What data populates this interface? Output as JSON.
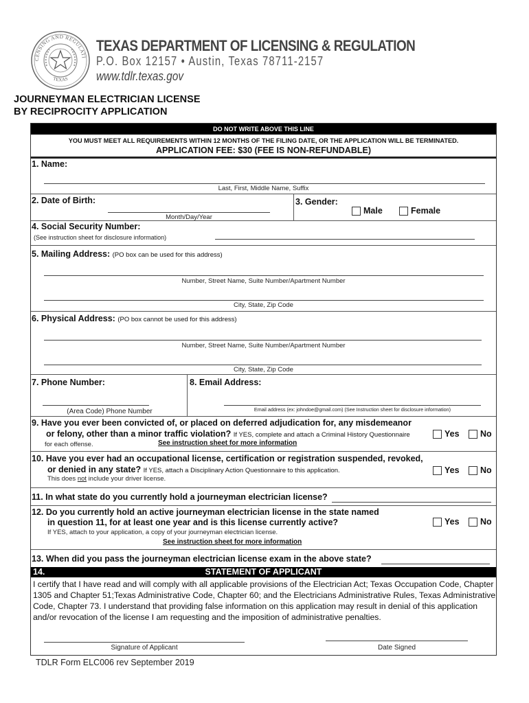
{
  "header": {
    "seal_icon": "tdlr-seal-icon",
    "seal_text_top": "LICENSING AND REGULATION",
    "seal_text_bottom": "TEXAS",
    "agency": "TEXAS DEPARTMENT OF LICENSING & REGULATION",
    "address": "P.O. Box 12157 • Austin, Texas 78711-2157",
    "website": "www.tdlr.texas.gov",
    "form_title_line1": "JOURNEYMAN ELECTRICIAN LICENSE",
    "form_title_line2": "BY RECIPROCITY APPLICATION"
  },
  "banner": {
    "do_not_write": "DO NOT WRITE ABOVE THIS LINE",
    "requirement_notice": "YOU MUST MEET ALL REQUIREMENTS WITHIN 12 MONTHS OF THE FILING DATE, OR THE APPLICATION WILL BE TERMINATED.",
    "fee": "APPLICATION FEE: $30 (FEE IS NON-REFUNDABLE)"
  },
  "fields": {
    "name": {
      "label": "1. Name:",
      "caption": "Last, First, Middle Name, Suffix",
      "value": ""
    },
    "dob": {
      "label": "2. Date of Birth:",
      "caption": "Month/Day/Year",
      "value": ""
    },
    "gender": {
      "label": "3. Gender:",
      "options": [
        "Male",
        "Female"
      ],
      "selected": null
    },
    "ssn": {
      "label": "4. Social Security Number:",
      "note": "(See instruction sheet for disclosure information)",
      "value": ""
    },
    "mailing": {
      "label": "5. Mailing Address:",
      "note": "(PO box can be used for this address)",
      "caption_street": "Number, Street Name, Suite Number/Apartment Number",
      "caption_city": "City, State, Zip Code"
    },
    "physical": {
      "label": "6. Physical Address:",
      "note": "(PO box cannot be used for this address)",
      "caption_street": "Number, Street Name, Suite Number/Apartment Number",
      "caption_city": "City, State, Zip Code"
    },
    "phone": {
      "label": "7. Phone Number:",
      "caption": "(Area Code) Phone Number",
      "value": ""
    },
    "email": {
      "label": "8. Email Address:",
      "caption": "Email address (ex: johndoe@gmail.com) (See Instruction sheet for disclosure information)",
      "value": ""
    }
  },
  "questions": {
    "q9": {
      "line1": "9.  Have you ever been convicted of, or placed on deferred adjudication for, any misdemeanor",
      "line2": "or felony, other than a minor traffic violation?",
      "note": "If YES, complete and attach a Criminal History Questionnaire",
      "note2": "for each offense.",
      "link": "See instruction sheet for more information",
      "yes": "Yes",
      "no": "No"
    },
    "q10": {
      "line1": "10. Have you ever had an occupational license, certification or registration suspended, revoked,",
      "line2": "or denied in any state?",
      "note": "If YES, attach a Disciplinary Action Questionnaire to this application.",
      "note2_pre": "This does ",
      "note2_em": "not",
      "note2_post": " include your driver license.",
      "yes": "Yes",
      "no": "No"
    },
    "q11": {
      "text": "11. In what state do you currently hold a journeyman electrician license?",
      "value": ""
    },
    "q12": {
      "line1": "12. Do you currently hold an active journeyman electrician license in the state named",
      "line2": "in question 11, for at least one year and is this license currently active?",
      "note": "If YES, attach to your application, a copy of your journeyman electrician license.",
      "link": "See instruction sheet for more information",
      "yes": "Yes",
      "no": "No"
    },
    "q13": {
      "text": "13. When did you pass the journeyman electrician license exam in the above state?",
      "value": ""
    }
  },
  "statement": {
    "number": "14.",
    "title": "STATEMENT OF APPLICANT",
    "body": "I certify that I have read and will comply with all applicable provisions of the Electrician Act; Texas Occupation Code, Chapter 1305 and Chapter 51;Texas Administrative Code, Chapter 60; and the Electricians Administrative Rules, Texas Administrative Code, Chapter 73. I understand that providing false information on this application may result in denial of this application and/or revocation of the license I am requesting and the imposition of administrative penalties.",
    "signature_caption": "Signature of Applicant",
    "date_caption": "Date Signed"
  },
  "footer": {
    "form_id": "TDLR Form ELC006 rev September 2019"
  }
}
